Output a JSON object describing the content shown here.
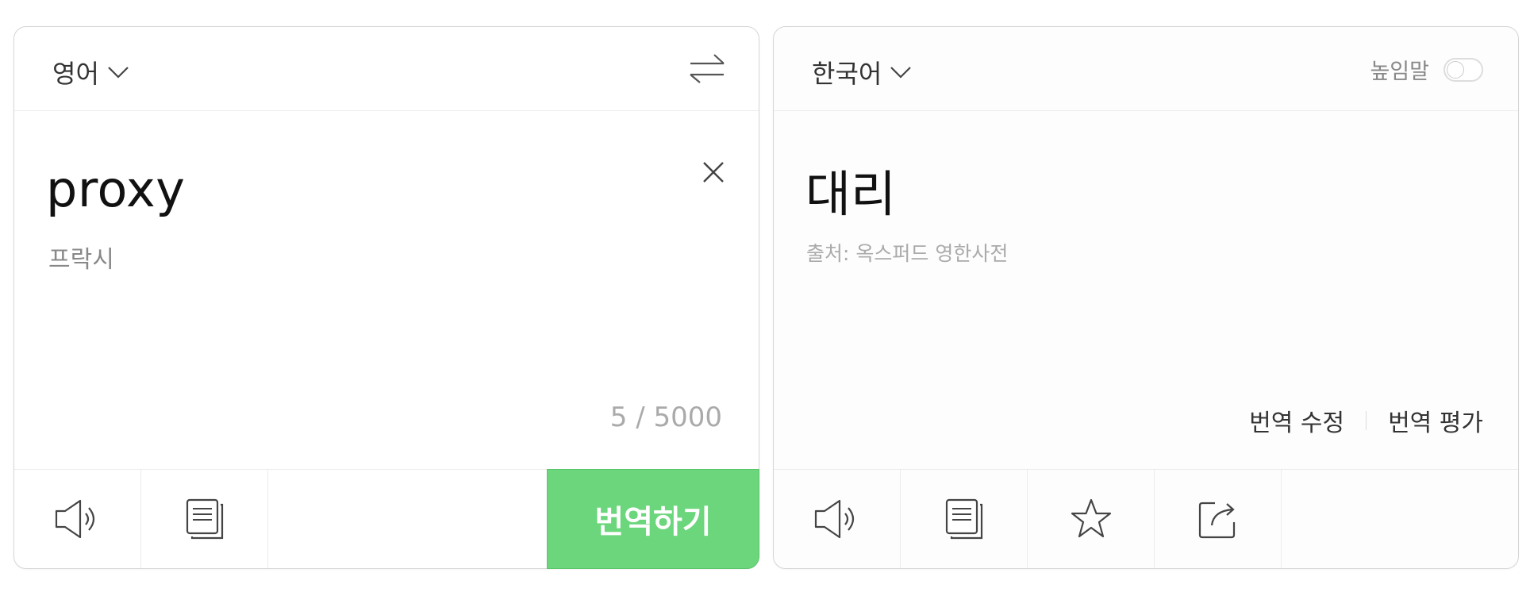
{
  "source_panel": {
    "language": "영어",
    "text": "proxy",
    "pronunciation": "프락시",
    "char_count": "5 / 5000",
    "translate_button": "번역하기"
  },
  "target_panel": {
    "language": "한국어",
    "honorific_label": "높임말",
    "honorific_enabled": false,
    "text": "대리",
    "source_credit": "출처: 옥스퍼드 영한사전",
    "edit_translation": "번역 수정",
    "rate_translation": "번역 평가"
  },
  "icons": {
    "language_dropdown": "chevron-down-icon",
    "swap": "swap-languages-icon",
    "clear": "close-icon",
    "listen": "speaker-icon",
    "copy": "copy-icon",
    "favorite": "star-icon",
    "share": "share-icon"
  },
  "colors": {
    "accent": "#6bd67b",
    "muted_text": "#aaaaaa"
  }
}
